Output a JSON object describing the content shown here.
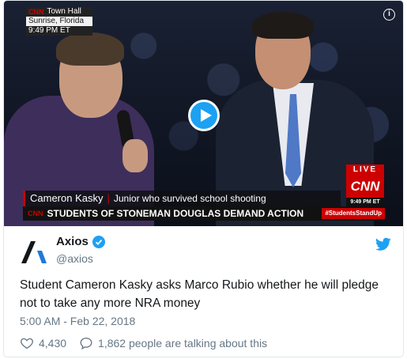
{
  "video": {
    "location_lines": [
      "Town Hall",
      "Sunrise, Florida",
      "9:49 PM ET"
    ],
    "network_mini": "CNN",
    "live_label": "LIVE",
    "network": "CNN",
    "time": "9:49 PM ET",
    "lower_third_name": "Cameron Kasky",
    "lower_third_desc": "Junior who survived school shooting",
    "ticker": "STUDENTS OF STONEMAN DOUGLAS DEMAND ACTION",
    "hashtag": "#StudentsStandUp",
    "info_icon": "info-icon",
    "play_icon": "play-icon"
  },
  "tweet": {
    "author_name": "Axios",
    "author_handle": "@axios",
    "text": "Student Cameron Kasky asks Marco Rubio whether he will pledge not to take any more NRA money",
    "timestamp": "5:00 AM - Feb 22, 2018",
    "likes": "4,430",
    "replies_text": "1,862 people are talking about this"
  },
  "colors": {
    "twitter_blue": "#1da1f2",
    "cnn_red": "#cc0000",
    "muted_text": "#657786"
  }
}
